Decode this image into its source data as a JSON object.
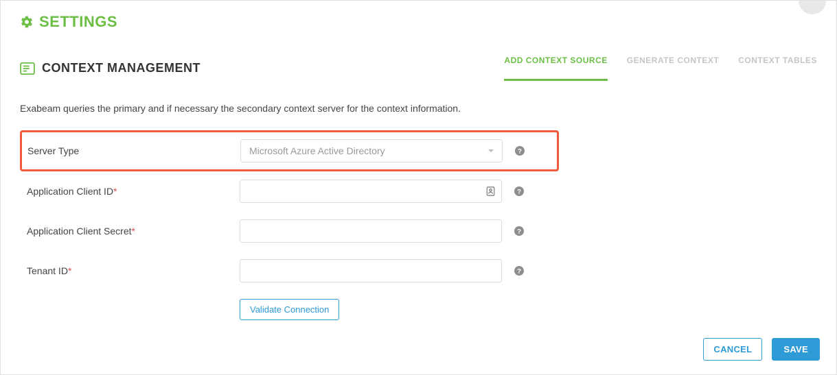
{
  "page_title": "SETTINGS",
  "section": {
    "title": "CONTEXT MANAGEMENT",
    "description": "Exabeam queries the primary and if necessary the secondary context server for the context information."
  },
  "tabs": {
    "add_context_source": "ADD CONTEXT SOURCE",
    "generate_context": "GENERATE CONTEXT",
    "context_tables": "CONTEXT TABLES"
  },
  "form": {
    "server_type": {
      "label": "Server Type",
      "value": "Microsoft Azure Active Directory"
    },
    "app_client_id": {
      "label": "Application Client ID",
      "value": ""
    },
    "app_client_secret": {
      "label": "Application Client Secret",
      "value": ""
    },
    "tenant_id": {
      "label": "Tenant ID",
      "value": ""
    },
    "validate_label": "Validate Connection"
  },
  "actions": {
    "cancel": "CANCEL",
    "save": "SAVE"
  }
}
